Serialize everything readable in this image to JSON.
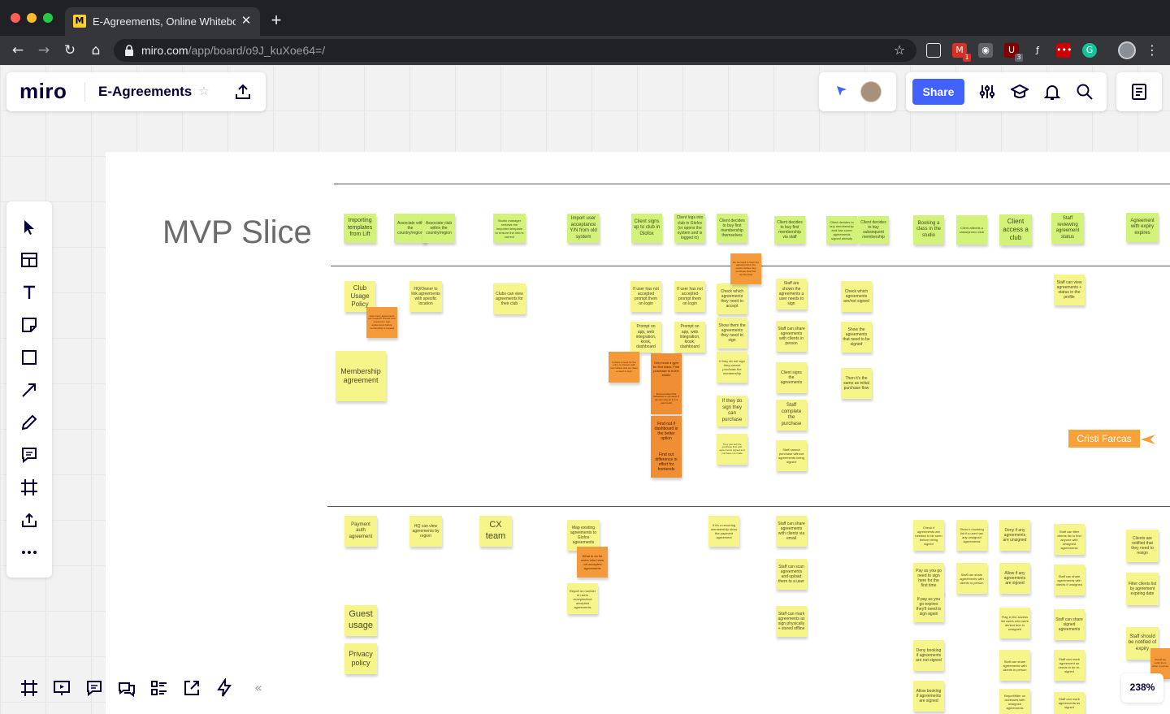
{
  "browser": {
    "tab_title": "E-Agreements, Online Whiteboard",
    "tab_favicon_text": "M",
    "url_host": "miro.com",
    "url_path": "/app/board/o9J_kuXoe64=/",
    "extensions": [
      {
        "name": "gmail-icon",
        "badge": "1",
        "color": "#d93025"
      },
      {
        "name": "camera-icon",
        "badge": "",
        "color": "#5f6368"
      },
      {
        "name": "ublock-icon",
        "badge": "3",
        "color": "#800000"
      },
      {
        "name": "formula-icon",
        "badge": "",
        "color": "#35363a"
      },
      {
        "name": "lastpass-icon",
        "badge": "",
        "color": "#cc0000"
      },
      {
        "name": "grammarly-icon",
        "badge": "",
        "color": "#15c39a"
      }
    ]
  },
  "miro": {
    "logo": "miro",
    "board_name": "E-Agreements",
    "share_label": "Share",
    "zoom": "238%",
    "accent": "#4262ff"
  },
  "board": {
    "title": "MVP Slice",
    "collaborator_cursor_name": "Cristi Farcas",
    "stickies": [
      {
        "id": "s1",
        "text": "Importing templates from Lift",
        "color": "g",
        "fs": 7
      },
      {
        "id": "s2",
        "text": "Associate with the country/region",
        "color": "g",
        "fs": 5
      },
      {
        "id": "s3",
        "text": "Associate club within the country/region",
        "color": "g",
        "fs": 5
      },
      {
        "id": "s4",
        "text": "Studio manager reviews the imported template to ensure the info is correct",
        "color": "g",
        "fs": 4
      },
      {
        "id": "s5",
        "text": "Import user acceptance Y/N from old system",
        "color": "g",
        "fs": 6
      },
      {
        "id": "s6",
        "text": "Client signs up to club in Glofox",
        "color": "g",
        "fs": 6
      },
      {
        "id": "s7",
        "text": "Client logs into club in Glofox (or opens the system and is logged in)",
        "color": "g",
        "fs": 5
      },
      {
        "id": "s8",
        "text": "Client decides to buy first membership themselves",
        "color": "g",
        "fs": 5
      },
      {
        "id": "s9",
        "text": "Client decides to buy first membership via staff",
        "color": "g",
        "fs": 5
      },
      {
        "id": "s10",
        "text": "Client decides to buy membership and has some agreements signed already",
        "color": "g",
        "fs": 4
      },
      {
        "id": "s11",
        "text": "Client decides to buy subsequent membership",
        "color": "g",
        "fs": 5
      },
      {
        "id": "s12",
        "text": "Booking a class in the studio",
        "color": "g",
        "fs": 6
      },
      {
        "id": "s13",
        "text": "Client attends a class/promo club",
        "color": "g",
        "fs": 4
      },
      {
        "id": "s14",
        "text": "Client access a club",
        "color": "g",
        "fs": 8
      },
      {
        "id": "s15",
        "text": "Staff reviewing agreement status",
        "color": "g",
        "fs": 6
      },
      {
        "id": "s16",
        "text": "Agreement with expiry expires",
        "color": "g",
        "fs": 6
      },
      {
        "id": "m1",
        "text": "Club Usage Policy",
        "color": "y",
        "fs": 8
      },
      {
        "id": "m2",
        "text": "How many agreements are needed? Should it be required to sign agreements before membership is created",
        "color": "o",
        "fs": 3
      },
      {
        "id": "m3",
        "text": "HQ/Owner to link agreements with specific location",
        "color": "y",
        "fs": 5
      },
      {
        "id": "m4",
        "text": "Clubs can view agreements for their club",
        "color": "y",
        "fs": 5
      },
      {
        "id": "m5",
        "text": "If user has not accepted prompt them on login",
        "color": "y",
        "fs": 5
      },
      {
        "id": "m6",
        "text": "If user has not accepted prompt them on login",
        "color": "y",
        "fs": 5
      },
      {
        "id": "m7",
        "text": "Check which agreements they need to accept",
        "color": "y",
        "fs": 5
      },
      {
        "id": "m8",
        "text": "Do we need to have the agreements in the system before they purchase their first membership",
        "color": "o",
        "fs": 3
      },
      {
        "id": "m9",
        "text": "Staff are shown the agreements a user needs to sign",
        "color": "y",
        "fs": 5
      },
      {
        "id": "m10",
        "text": "Check which agreements are/not signed",
        "color": "y",
        "fs": 5
      },
      {
        "id": "m11",
        "text": "Staff can view agreements + status in the profile",
        "color": "y",
        "fs": 5
      },
      {
        "id": "m12",
        "text": "Membership agreement",
        "color": "y",
        "fs": 9
      },
      {
        "id": "m13",
        "text": "Prompt on app, web integration, kiosk, dashboard",
        "color": "y",
        "fs": 5
      },
      {
        "id": "m14",
        "text": "Prompt on app, web integration, kiosk, dashboard",
        "color": "y",
        "fs": 5
      },
      {
        "id": "m15",
        "text": "Show them the agreements they need to sign",
        "color": "y",
        "fs": 5
      },
      {
        "id": "m16",
        "text": "Staff can share agreements with clients in person",
        "color": "y",
        "fs": 5
      },
      {
        "id": "m17",
        "text": "Show the agreements that need to be signed",
        "color": "y",
        "fs": 5
      },
      {
        "id": "m18",
        "text": "Is there a need for the entry on classes with new tablets and are there a need to sign",
        "color": "o",
        "fs": 3
      },
      {
        "id": "m19",
        "text": "Only book a gym for first class. First purchase is in the studio",
        "color": "d",
        "fs": 4
      },
      {
        "id": "m20",
        "text": "If they do not sign they cannot purchase the membership",
        "color": "y",
        "fs": 4
      },
      {
        "id": "m21",
        "text": "Client signs the agreements",
        "color": "y",
        "fs": 5
      },
      {
        "id": "m22",
        "text": "Then it's the same as initial purchase flow",
        "color": "y",
        "fs": 5
      },
      {
        "id": "m23",
        "text": "Find out when first behaviour is not used. If we can only do it in a new booth",
        "color": "d",
        "fs": 3
      },
      {
        "id": "m24",
        "text": "If they do sign they can purchase",
        "color": "y",
        "fs": 6
      },
      {
        "id": "m25",
        "text": "Staff complete the purchase",
        "color": "y",
        "fs": 6
      },
      {
        "id": "m26",
        "text": "Find out if dashboard is the better option",
        "color": "d",
        "fs": 5
      },
      {
        "id": "m27",
        "text": "They can exit the purchase flow with agreements signed and purchase not made",
        "color": "y",
        "fs": 3
      },
      {
        "id": "m28",
        "text": "Staff cannot purchase without agreements being signed",
        "color": "y",
        "fs": 4
      },
      {
        "id": "m29",
        "text": "Find out difference in effort for frontends",
        "color": "d",
        "fs": 5
      },
      {
        "id": "b1",
        "text": "Payment auth agreement",
        "color": "y",
        "fs": 6
      },
      {
        "id": "b2",
        "text": "HQ can view agreements by region",
        "color": "y",
        "fs": 5
      },
      {
        "id": "b3",
        "text": "CX team",
        "color": "y",
        "fs": 11
      },
      {
        "id": "b4",
        "text": "Map existing agreements to Glofox agreements",
        "color": "y",
        "fs": 5
      },
      {
        "id": "b5",
        "text": "What to do for users who have not accepted agreements",
        "color": "o",
        "fs": 4
      },
      {
        "id": "b6",
        "text": "Report on number of users accepted/not accepted agreements",
        "color": "y",
        "fs": 4
      },
      {
        "id": "b7",
        "text": "If it's a recurring membership show the payment agreement",
        "color": "y",
        "fs": 4
      },
      {
        "id": "b8",
        "text": "Staff can share agreements with clients via email",
        "color": "y",
        "fs": 5
      },
      {
        "id": "b9",
        "text": "Staff can scan agreements and upload them to a user",
        "color": "y",
        "fs": 5
      },
      {
        "id": "b10",
        "text": "Staff can mark agreements as sign physically + stored offline",
        "color": "y",
        "fs": 5
      },
      {
        "id": "b11",
        "text": "Check if agreements are needed to be seen before being signed",
        "color": "y",
        "fs": 4
      },
      {
        "id": "b12",
        "text": "Pay as you go need to sign here for the first time",
        "color": "y",
        "fs": 5
      },
      {
        "id": "b13",
        "text": "If pay as you go expires they'll need to sign again",
        "color": "y",
        "fs": 5
      },
      {
        "id": "b14",
        "text": "Show in booking list if a user has any unsigned agreements",
        "color": "y",
        "fs": 4
      },
      {
        "id": "b15",
        "text": "Staff can share agreements with clients in person",
        "color": "y",
        "fs": 4
      },
      {
        "id": "b16",
        "text": "Deny if any agreements are unsigned",
        "color": "y",
        "fs": 5
      },
      {
        "id": "b17",
        "text": "Allow if any agreements are signed",
        "color": "y",
        "fs": 5
      },
      {
        "id": "b18",
        "text": "Flag in the access list users who were denied due to unsigned",
        "color": "y",
        "fs": 4
      },
      {
        "id": "b19",
        "text": "Staff can share agreements with clients in person",
        "color": "y",
        "fs": 4
      },
      {
        "id": "b20",
        "text": "Report/filter on accesses with unsigned agreements",
        "color": "y",
        "fs": 4
      },
      {
        "id": "b21",
        "text": "Staff can filter clients list to find anyone with unsigned agreements",
        "color": "y",
        "fs": 4
      },
      {
        "id": "b22",
        "text": "Staff can share agreements with clients if unsigned",
        "color": "y",
        "fs": 4
      },
      {
        "id": "b23",
        "text": "Staff can share signed agreements",
        "color": "y",
        "fs": 5
      },
      {
        "id": "b24",
        "text": "Staff can mark agreement as needs to be re-signed",
        "color": "y",
        "fs": 4
      },
      {
        "id": "b25",
        "text": "Staff can mark agreements as signed",
        "color": "y",
        "fs": 4
      },
      {
        "id": "b26",
        "text": "Deny booking if agreements are not signed",
        "color": "y",
        "fs": 5
      },
      {
        "id": "b27",
        "text": "Allow booking if agreements are signed",
        "color": "y",
        "fs": 5
      },
      {
        "id": "b28",
        "text": "Guest usage",
        "color": "y",
        "fs": 11
      },
      {
        "id": "b29",
        "text": "Privacy policy",
        "color": "y",
        "fs": 9
      },
      {
        "id": "b30",
        "text": "Clients are notified that they need to resign",
        "color": "y",
        "fs": 5
      },
      {
        "id": "b31",
        "text": "Filter clients list by agreement expiring date",
        "color": "y",
        "fs": 5
      },
      {
        "id": "b32",
        "text": "Staff should be notified of expiry",
        "color": "y",
        "fs": 6
      },
      {
        "id": "b33",
        "text": "Should we notify them when it expires",
        "color": "o",
        "fs": 3
      }
    ]
  }
}
